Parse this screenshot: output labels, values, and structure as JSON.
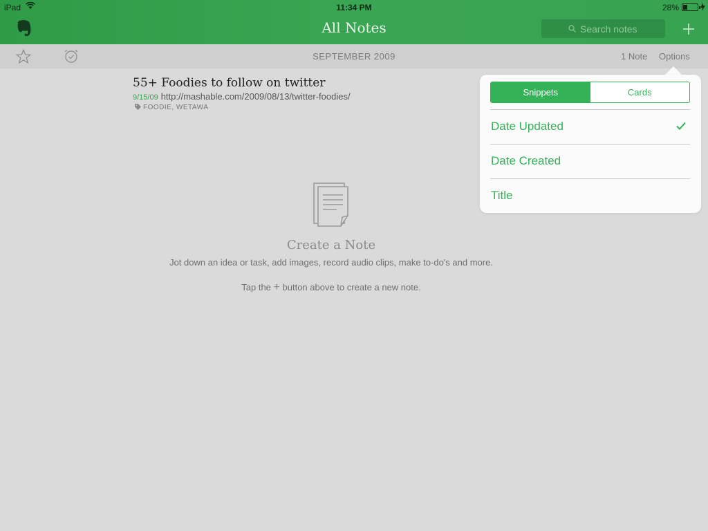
{
  "status_bar": {
    "device": "iPad",
    "time": "11:34 PM",
    "battery_percent": "28%",
    "battery_level": 0.28
  },
  "header": {
    "title": "All Notes",
    "search_placeholder": "Search notes",
    "accent_color": "#3aa552"
  },
  "subbar": {
    "month": "SEPTEMBER 2009",
    "note_count": "1 Note",
    "options_label": "Options"
  },
  "notes": [
    {
      "title": "55+ Foodies to follow on twitter",
      "date": "9/15/09",
      "snippet": "http://mashable.com/2009/08/13/twitter-foodies/",
      "tags": "FOODIE, WETAWA"
    }
  ],
  "empty_state": {
    "title": "Create a Note",
    "description": "Jot down an idea or task, add images, record audio clips, make to-do's and more.",
    "tip_before": "Tap the",
    "tip_glyph": "+",
    "tip_after": "button above to create a new note."
  },
  "options_popover": {
    "view_modes": [
      "Snippets",
      "Cards"
    ],
    "active_view": "Snippets",
    "sort_options": [
      "Date Updated",
      "Date Created",
      "Title"
    ],
    "selected_sort": "Date Updated",
    "accent_color": "#34b257"
  }
}
